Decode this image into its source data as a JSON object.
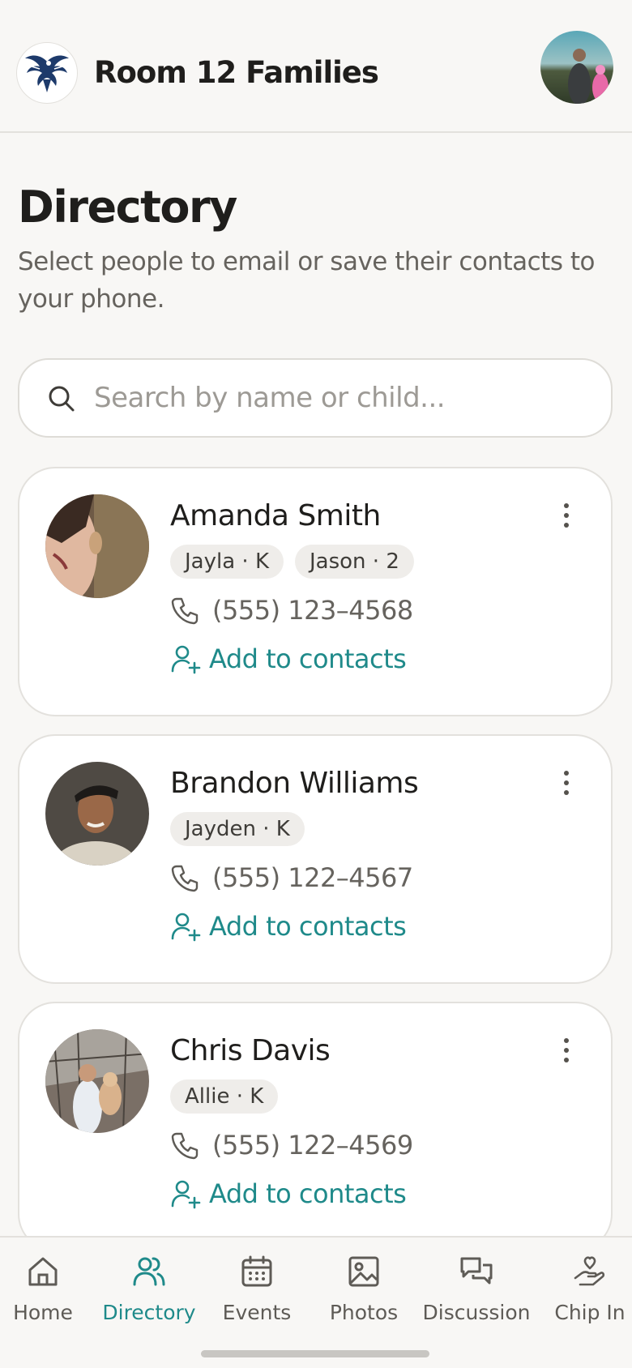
{
  "header": {
    "app_title": "Room 12 Families",
    "logo_icon": "eagle-logo-icon",
    "user_avatar": "user-profile-avatar"
  },
  "page": {
    "title": "Directory",
    "subtitle": "Select people to email or save their contacts to your phone."
  },
  "search": {
    "placeholder": "Search by name or child...",
    "value": ""
  },
  "contacts": [
    {
      "name": "Amanda Smith",
      "children": [
        "Jayla · K",
        "Jason · 2"
      ],
      "phone": "(555) 123–4568",
      "add_label": "Add to contacts"
    },
    {
      "name": "Brandon Williams",
      "children": [
        "Jayden · K"
      ],
      "phone": "(555) 122–4567",
      "add_label": "Add to contacts"
    },
    {
      "name": "Chris Davis",
      "children": [
        "Allie · K"
      ],
      "phone": "(555) 122–4569",
      "add_label": "Add to contacts"
    }
  ],
  "nav": {
    "items": [
      {
        "label": "Home",
        "icon": "home-icon"
      },
      {
        "label": "Directory",
        "icon": "people-icon",
        "active": true
      },
      {
        "label": "Events",
        "icon": "calendar-icon"
      },
      {
        "label": "Photos",
        "icon": "image-icon"
      },
      {
        "label": "Discussion",
        "icon": "chat-icon"
      },
      {
        "label": "Chip In",
        "icon": "hand-heart-icon"
      }
    ]
  },
  "colors": {
    "accent": "#1f8a8a",
    "background": "#f8f7f5",
    "card": "#ffffff",
    "chip": "#efedea",
    "muted_text": "#66635e"
  }
}
